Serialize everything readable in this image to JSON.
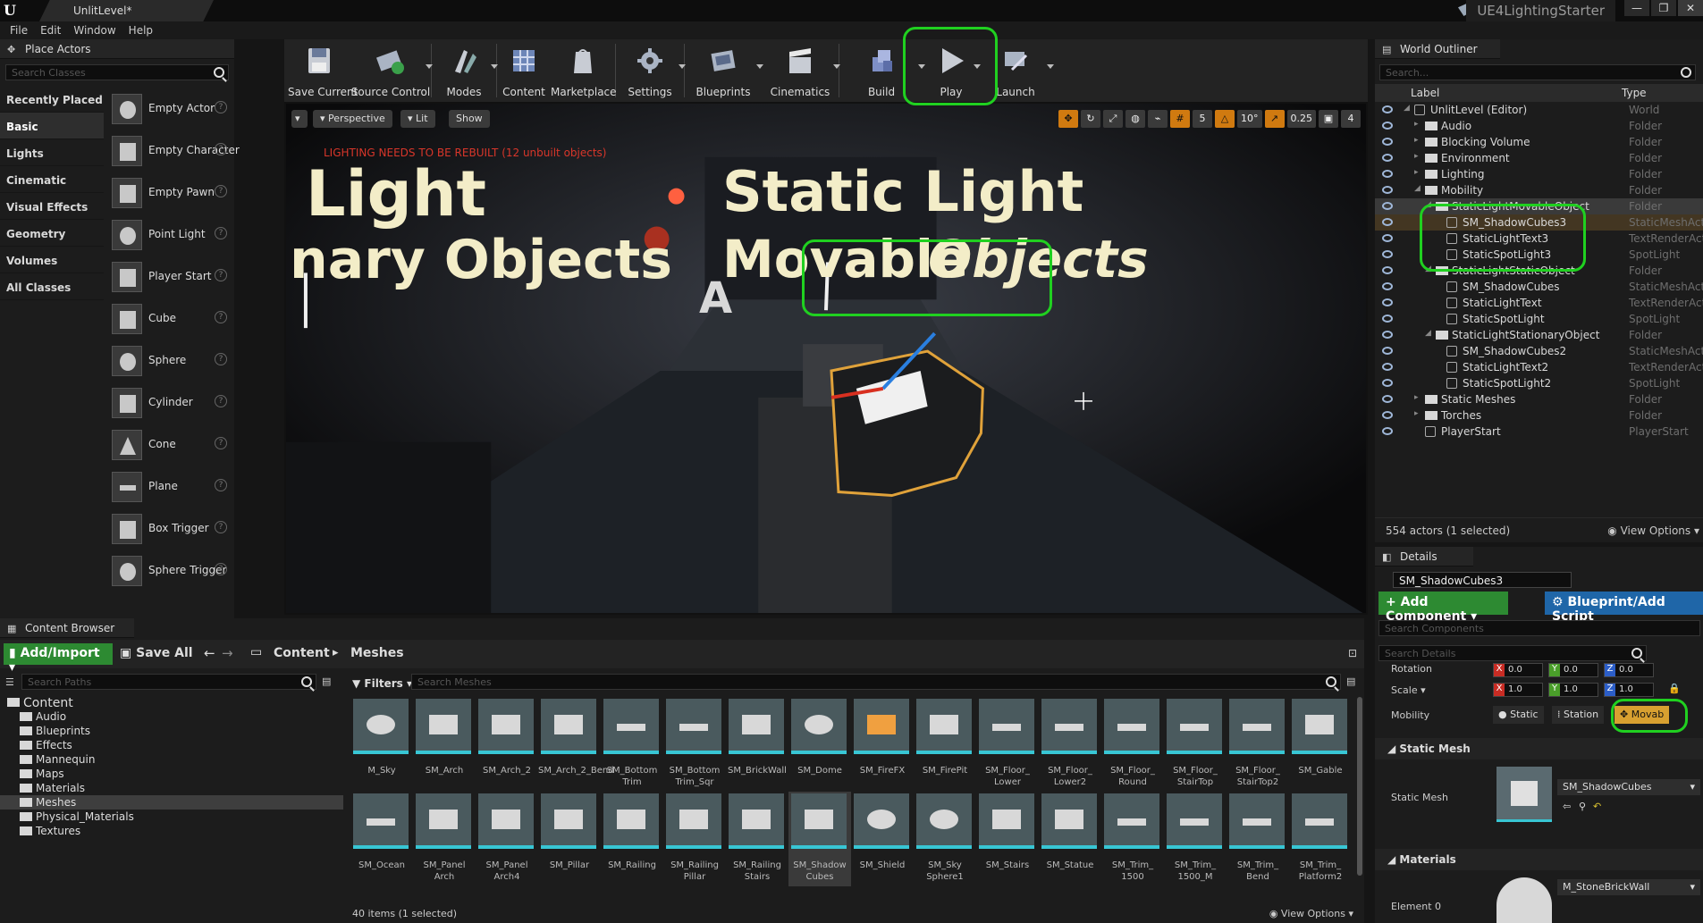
{
  "window": {
    "tab_title": "UnlitLevel*",
    "project_name": "UE4LightingStarter",
    "controls": [
      "—",
      "❐",
      "✕"
    ]
  },
  "menu": [
    "File",
    "Edit",
    "Window",
    "Help"
  ],
  "place_actors": {
    "title": "Place Actors",
    "search_placeholder": "Search Classes",
    "categories": [
      "Recently Placed",
      "Basic",
      "Lights",
      "Cinematic",
      "Visual Effects",
      "Geometry",
      "Volumes",
      "All Classes"
    ],
    "active_category": "Basic",
    "items": [
      "Empty Actor",
      "Empty Character",
      "Empty Pawn",
      "Point Light",
      "Player Start",
      "Cube",
      "Sphere",
      "Cylinder",
      "Cone",
      "Plane",
      "Box Trigger",
      "Sphere Trigger"
    ],
    "help_glyph": "?"
  },
  "toolbar": {
    "buttons": [
      "Save Current",
      "Source Control",
      "Modes",
      "Content",
      "Marketplace",
      "Settings",
      "Blueprints",
      "Cinematics",
      "Build",
      "Play",
      "Launch"
    ]
  },
  "viewport": {
    "perspective": "Perspective",
    "lit": "Lit",
    "show": "Show",
    "warning": "LIGHTING NEEDS TO BE REBUILT (12 unbuilt objects)",
    "grid_snap": "5",
    "rotation_snap": "10°",
    "scale_snap": "0.25",
    "camera_speed": "4",
    "text_light": "Light",
    "text_nary_objects": "nary Objects",
    "text_static_light": "Static Light",
    "text_movable": "Movable",
    "text_objects": "Objects",
    "text_a": "A"
  },
  "world_outliner": {
    "title": "World Outliner",
    "search_placeholder": "Search...",
    "col_label": "Label",
    "col_type": "Type",
    "rows": [
      {
        "name": "UnlitLevel (Editor)",
        "type": "World",
        "depth": 0,
        "kind": "world"
      },
      {
        "name": "Audio",
        "type": "Folder",
        "depth": 1,
        "kind": "folder"
      },
      {
        "name": "Blocking Volume",
        "type": "Folder",
        "depth": 1,
        "kind": "folder"
      },
      {
        "name": "Environment",
        "type": "Folder",
        "depth": 1,
        "kind": "folder"
      },
      {
        "name": "Lighting",
        "type": "Folder",
        "depth": 1,
        "kind": "folder"
      },
      {
        "name": "Mobility",
        "type": "Folder",
        "depth": 1,
        "kind": "folder"
      },
      {
        "name": "StaticLightMovableObject",
        "type": "Folder",
        "depth": 2,
        "kind": "folder",
        "hl": "sel2"
      },
      {
        "name": "SM_ShadowCubes3",
        "type": "StaticMeshActor",
        "depth": 3,
        "kind": "actor",
        "hl": "selected"
      },
      {
        "name": "StaticLightText3",
        "type": "TextRenderActor",
        "depth": 3,
        "kind": "actor"
      },
      {
        "name": "StaticSpotLight3",
        "type": "SpotLight",
        "depth": 3,
        "kind": "actor"
      },
      {
        "name": "StaticLightStaticObject",
        "type": "Folder",
        "depth": 2,
        "kind": "folder"
      },
      {
        "name": "SM_ShadowCubes",
        "type": "StaticMeshActor",
        "depth": 3,
        "kind": "actor"
      },
      {
        "name": "StaticLightText",
        "type": "TextRenderActor",
        "depth": 3,
        "kind": "actor"
      },
      {
        "name": "StaticSpotLight",
        "type": "SpotLight",
        "depth": 3,
        "kind": "actor"
      },
      {
        "name": "StaticLightStationaryObject",
        "type": "Folder",
        "depth": 2,
        "kind": "folder"
      },
      {
        "name": "SM_ShadowCubes2",
        "type": "StaticMeshActor",
        "depth": 3,
        "kind": "actor"
      },
      {
        "name": "StaticLightText2",
        "type": "TextRenderActor",
        "depth": 3,
        "kind": "actor"
      },
      {
        "name": "StaticSpotLight2",
        "type": "SpotLight",
        "depth": 3,
        "kind": "actor"
      },
      {
        "name": "Static Meshes",
        "type": "Folder",
        "depth": 1,
        "kind": "folder"
      },
      {
        "name": "Torches",
        "type": "Folder",
        "depth": 1,
        "kind": "folder"
      },
      {
        "name": "PlayerStart",
        "type": "PlayerStart",
        "depth": 1,
        "kind": "actor"
      }
    ],
    "actor_count": "554 actors (1 selected)",
    "view_options": "View Options"
  },
  "details": {
    "title": "Details",
    "selected_name": "SM_ShadowCubes3",
    "add_component": "+ Add Component",
    "blueprint_script": "Blueprint/Add Script",
    "search_components": "Search Components",
    "search_details": "Search Details",
    "rotation_label": "Rotation",
    "scale_label": "Scale",
    "rotation": [
      "0.0",
      "0.0",
      "0.0"
    ],
    "scale": [
      "1.0",
      "1.0",
      "1.0"
    ],
    "mobility_label": "Mobility",
    "mobility_options": [
      "Static",
      "Station",
      "Movab"
    ],
    "mobility_selected": "Movab",
    "static_mesh_section": "Static Mesh",
    "static_mesh_label": "Static Mesh",
    "static_mesh_value": "SM_ShadowCubes",
    "materials_section": "Materials",
    "element0_label": "Element 0",
    "element0_value": "M_StoneBrickWall"
  },
  "content_browser": {
    "title": "Content Browser",
    "add_import": "Add/Import",
    "save_all": "Save All",
    "breadcrumb": [
      "Content",
      "Meshes"
    ],
    "search_paths": "Search Paths",
    "filters": "Filters",
    "search_meshes": "Search Meshes",
    "tree": [
      {
        "name": "Content",
        "depth": 0
      },
      {
        "name": "Audio",
        "depth": 1
      },
      {
        "name": "Blueprints",
        "depth": 1
      },
      {
        "name": "Effects",
        "depth": 1
      },
      {
        "name": "Mannequin",
        "depth": 1
      },
      {
        "name": "Maps",
        "depth": 1
      },
      {
        "name": "Materials",
        "depth": 1
      },
      {
        "name": "Meshes",
        "depth": 1,
        "selected": true
      },
      {
        "name": "Physical_Materials",
        "depth": 1
      },
      {
        "name": "Textures",
        "depth": 1
      }
    ],
    "assets": [
      "M_Sky",
      "SM_Arch",
      "SM_Arch_2",
      "SM_Arch_2_Bend",
      "SM_Bottom Trim",
      "SM_Bottom Trim_Sqr",
      "SM_BrickWall",
      "SM_Dome",
      "SM_FireFX",
      "SM_FirePit",
      "SM_Floor_ Lower",
      "SM_Floor_ Lower2",
      "SM_Floor_ Round",
      "SM_Floor_ StairTop",
      "SM_Floor_ StairTop2",
      "SM_Gable",
      "SM_Ocean",
      "SM_Panel Arch",
      "SM_Panel Arch4",
      "SM_Pillar",
      "SM_Railing",
      "SM_Railing Pillar",
      "SM_Railing Stairs",
      "SM_Shadow Cubes",
      "SM_Shield",
      "SM_Sky Sphere1",
      "SM_Stairs",
      "SM_Statue",
      "SM_Trim_ 1500",
      "SM_Trim_ 1500_M",
      "SM_Trim_ Bend",
      "SM_Trim_ Platform2"
    ],
    "selected_asset": "SM_Shadow Cubes",
    "item_count": "40 items (1 selected)",
    "view_options": "View Options"
  },
  "colors": {
    "highlight": "#20d020",
    "accent_green": "#2d8a32",
    "accent_blue": "#1f66a8",
    "selection_orange": "#e0a23a",
    "warning_red": "#d8362a"
  }
}
